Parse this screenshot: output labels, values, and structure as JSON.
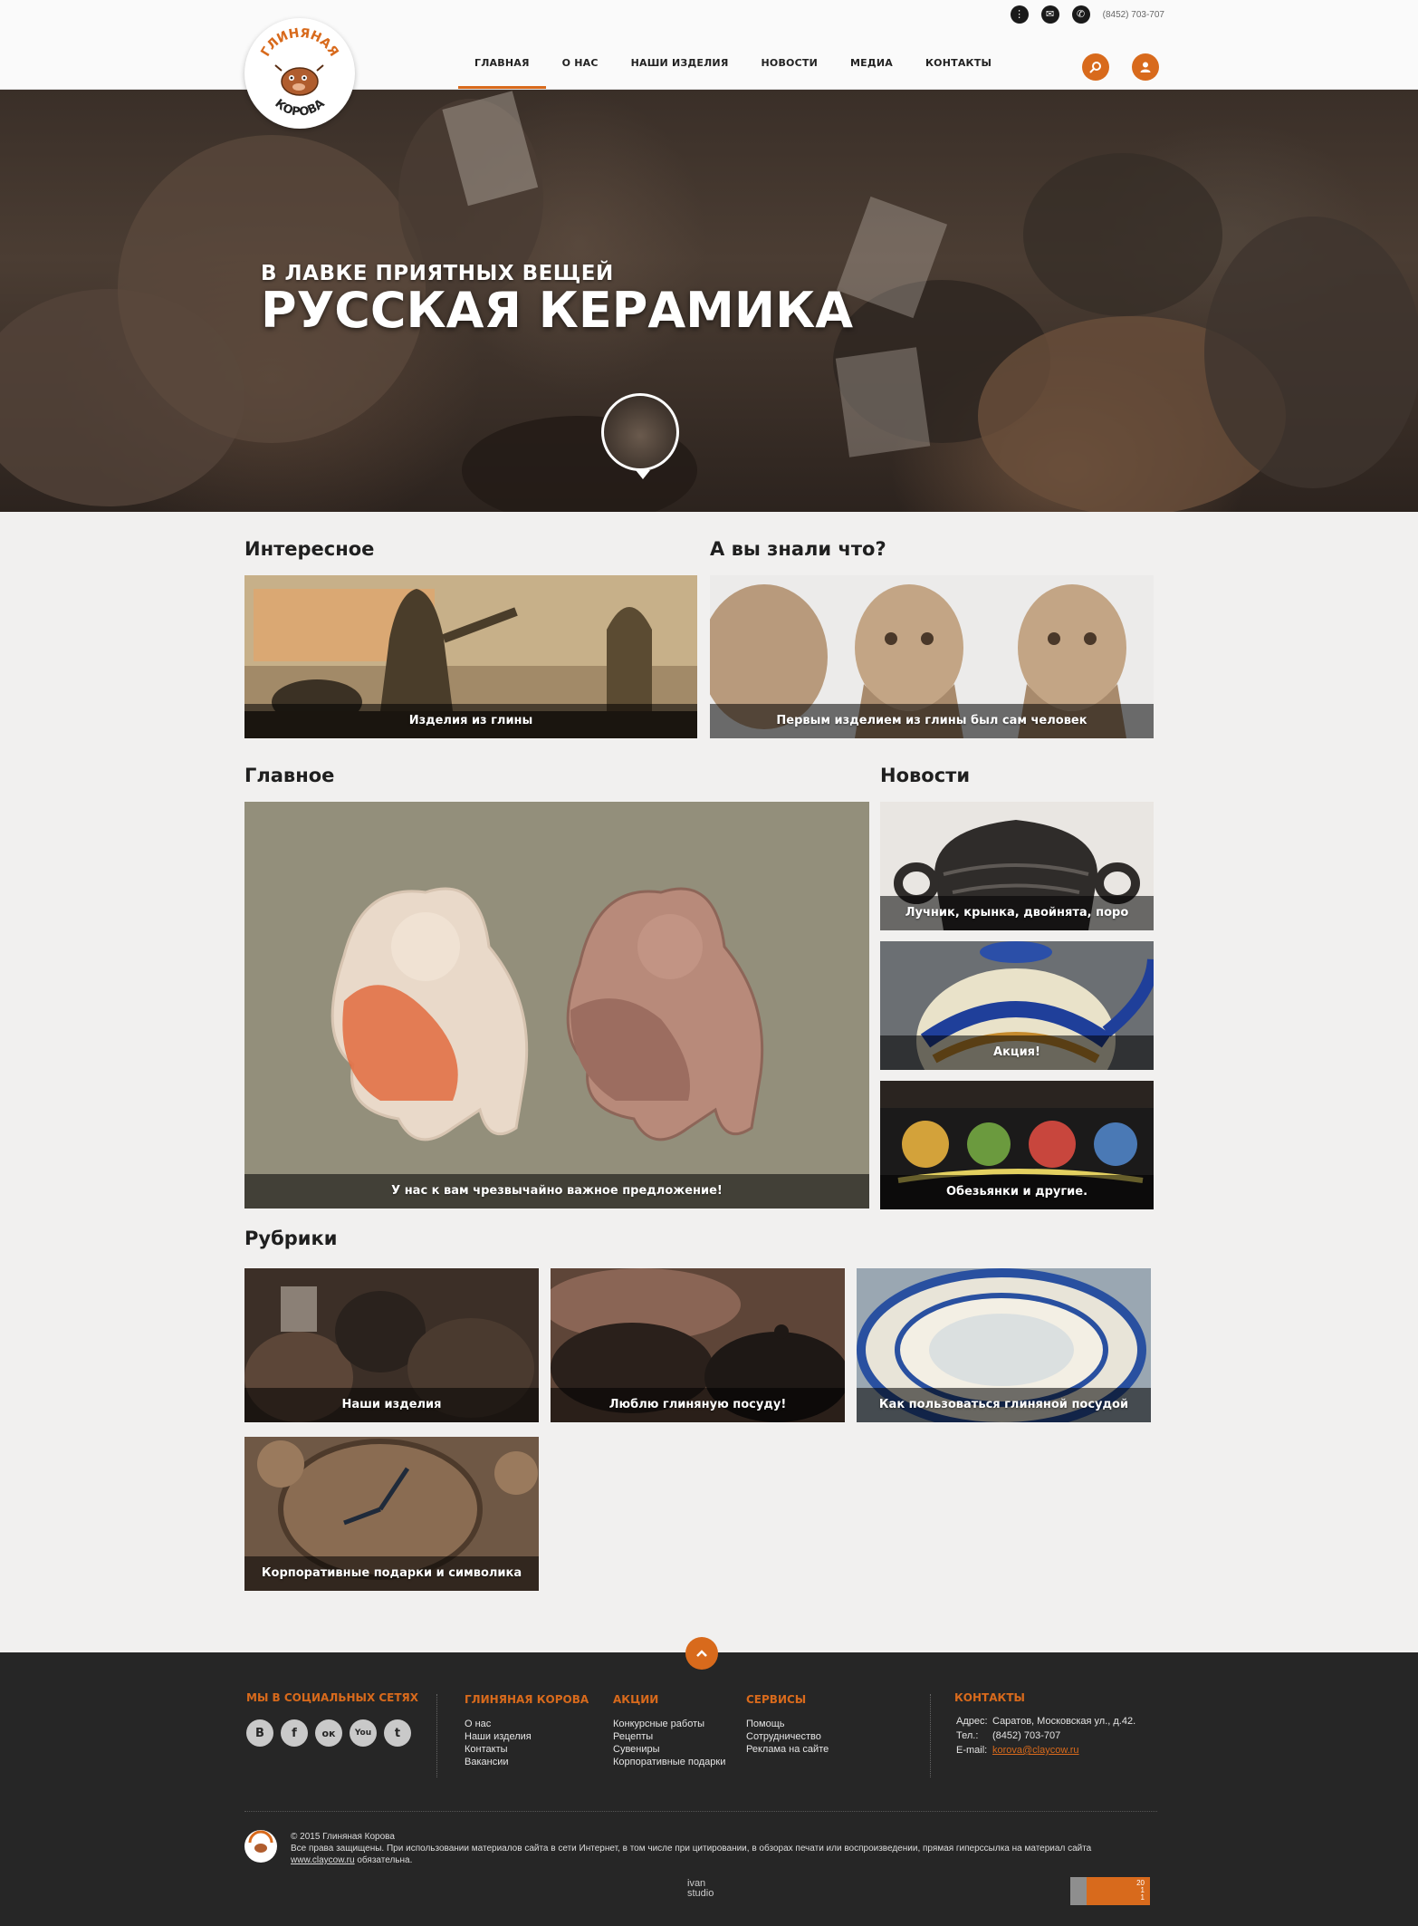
{
  "header": {
    "phone": "(8452) 703-707",
    "logo_text_top": "ГЛИНЯНАЯ",
    "logo_text_bottom": "КОРОВА",
    "nav": [
      "ГЛАВНАЯ",
      "О НАС",
      "НАШИ ИЗДЕЛИЯ",
      "НОВОСТИ",
      "МЕДИА",
      "КОНТАКТЫ"
    ],
    "active_nav": "ГЛАВНАЯ",
    "icons": [
      "sitemap-icon",
      "mail-icon",
      "phone-icon",
      "search-icon",
      "user-icon"
    ]
  },
  "hero": {
    "subtitle": "В ЛАВКЕ ПРИЯТНЫХ ВЕЩЕЙ",
    "title": "РУССКАЯ КЕРАМИКА",
    "slides_total": 9,
    "active_slide": 1
  },
  "sections": {
    "interesting": {
      "title": "Интересное",
      "card_caption": "Изделия из глины"
    },
    "did_you_know": {
      "title": "А вы знали что?",
      "card_caption": "Первым изделием из глины был сам человек"
    },
    "main": {
      "title": "Главное",
      "card_caption": "У нас к вам чрезвычайно важное предложение!"
    },
    "news": {
      "title": "Новости",
      "items": [
        "Лучник, крынка, двойнята, поро",
        "Акция!",
        "Обезьянки и другие."
      ]
    },
    "rubrics": {
      "title": "Рубрики",
      "items": [
        "Наши изделия",
        "Люблю глиняную посуду!",
        "Как пользоваться глиняной посудой",
        "Корпоративные подарки и символика"
      ]
    }
  },
  "footer": {
    "social_title": "МЫ В СОЦИАЛЬНЫХ СЕТЯХ",
    "social": [
      {
        "name": "vk-icon",
        "glyph": "В"
      },
      {
        "name": "facebook-icon",
        "glyph": "f"
      },
      {
        "name": "odnoklassniki-icon",
        "glyph": "ок"
      },
      {
        "name": "youtube-icon",
        "glyph": "You"
      },
      {
        "name": "twitter-icon",
        "glyph": "t"
      }
    ],
    "col1": {
      "title": "ГЛИНЯНАЯ КОРОВА",
      "links": [
        "О нас",
        "Наши изделия",
        "Контакты",
        "Вакансии"
      ]
    },
    "col2": {
      "title": "АКЦИИ",
      "links": [
        "Конкурсные работы",
        "Рецепты",
        "Сувениры",
        "Корпоративные подарки"
      ]
    },
    "col3": {
      "title": "СЕРВИСЫ",
      "links": [
        "Помощь",
        "Сотрудничество",
        "Реклама на сайте"
      ]
    },
    "contacts": {
      "title": "КОНТАКТЫ",
      "address_label": "Адрес:",
      "address": "Саратов, Московская ул., д.42.",
      "phone_label": "Тел.:",
      "phone": "(8452) 703-707",
      "email_label": "E-mail:",
      "email": "korova@claycow.ru"
    },
    "copyright": "© 2015 Глиняная Корова",
    "legal": "Все права защищены. При использовании материалов сайта в сети Интернет, в том числе при цитировании, в обзорах печати или воспроизведении, прямая гиперссылка на материал сайта",
    "legal_link": "www.claycow.ru",
    "legal_end": "обязательна.",
    "studio_line1": "ivan",
    "studio_line2": "studio",
    "counter": [
      "20",
      "1",
      "1"
    ]
  },
  "colors": {
    "accent": "#d86a1c",
    "footer_bg": "#262626",
    "page_bg": "#f1f0ef"
  }
}
